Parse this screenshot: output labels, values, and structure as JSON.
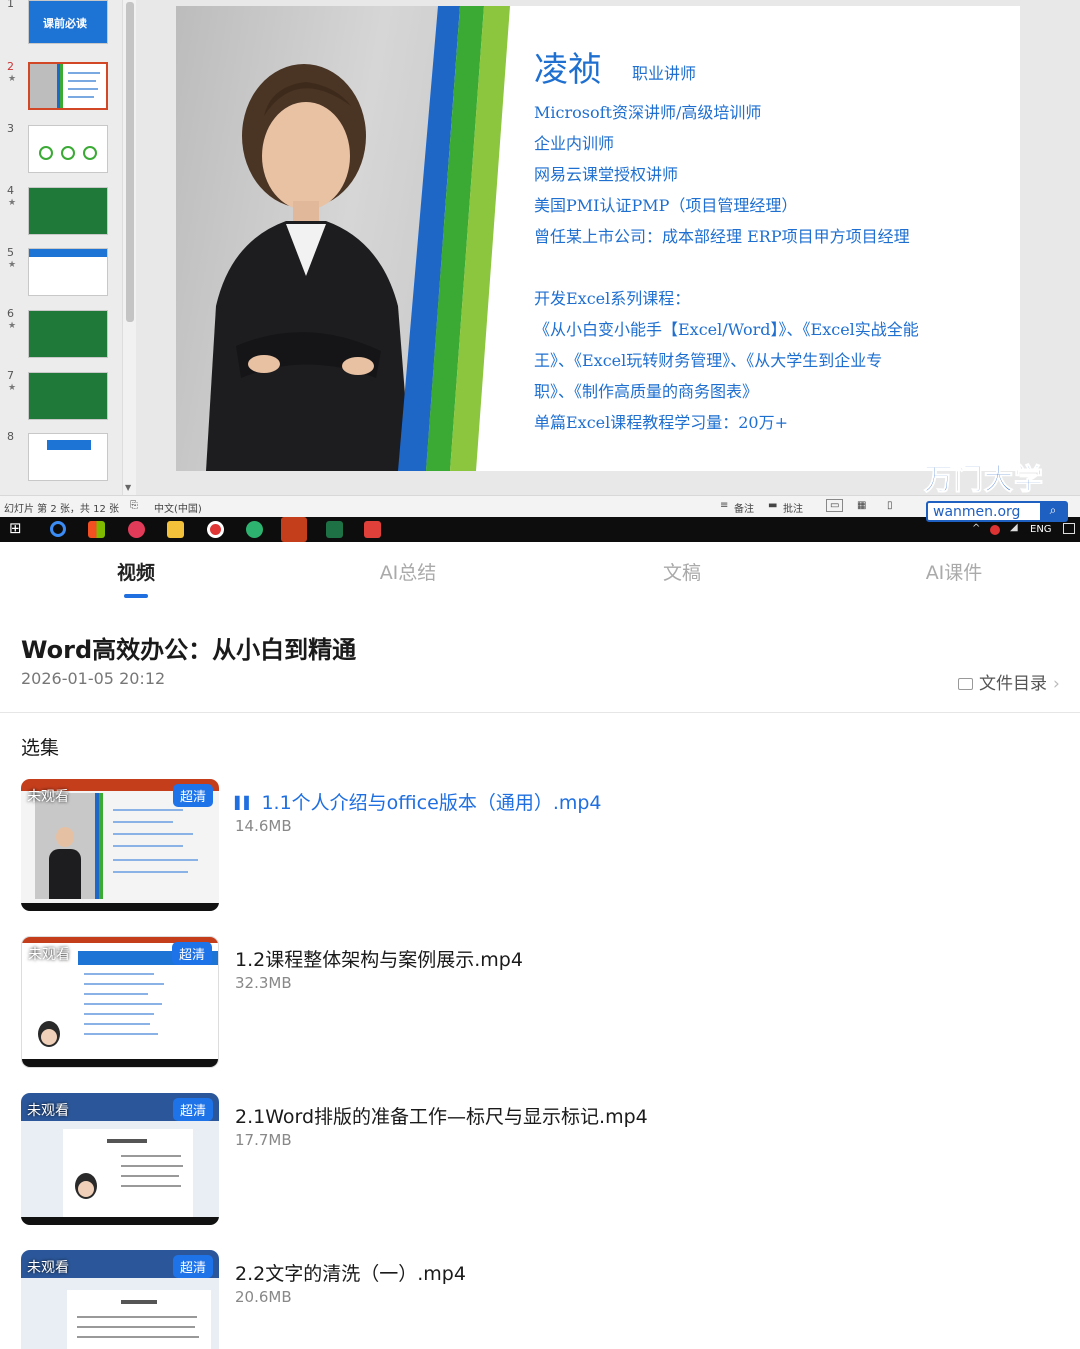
{
  "video": {
    "thumbnails": [
      {
        "num": "1",
        "star": "",
        "label": "课前必读"
      },
      {
        "num": "2",
        "star": "★",
        "label": ""
      },
      {
        "num": "3",
        "star": "",
        "label": ""
      },
      {
        "num": "4",
        "star": "★",
        "label": ""
      },
      {
        "num": "5",
        "star": "★",
        "label": ""
      },
      {
        "num": "6",
        "star": "★",
        "label": ""
      },
      {
        "num": "7",
        "star": "★",
        "label": ""
      },
      {
        "num": "8",
        "star": "",
        "label": ""
      }
    ],
    "slide": {
      "name": "凌祯",
      "role": "职业讲师",
      "lines": [
        "Microsoft资深讲师/高级培训师",
        "企业内训师",
        "网易云课堂授权讲师",
        "美国PMI认证PMP（项目管理经理）",
        "曾任某上市公司：成本部经理 ERP项目甲方项目经理",
        "",
        "开发Excel系列课程：",
        "《从小白变小能手【Excel/Word】》、《Excel实战全能",
        "王》、《Excel玩转财务管理》、《从大学生到企业专",
        "职》、《制作高质量的商务图表》",
        "单篇Excel课程教程学习量：20万+"
      ]
    },
    "statusbar": {
      "slide_info": "幻灯片 第 2 张，共 12 张",
      "language": "中文(中国)",
      "notes": "备注",
      "comments": "批注"
    },
    "taskbar": {
      "lang": "ENG"
    },
    "brand": {
      "name": "万门大学",
      "url": "wanmen.org"
    }
  },
  "tabs": [
    {
      "label": "视频",
      "active": true
    },
    {
      "label": "AI总结",
      "active": false
    },
    {
      "label": "文稿",
      "active": false
    },
    {
      "label": "AI课件",
      "active": false
    }
  ],
  "course": {
    "title": "Word高效办公：从小白到精通",
    "date": "2026-01-05 20:12",
    "catalog_label": "文件目录"
  },
  "playlist": {
    "heading": "选集",
    "episodes": [
      {
        "title": "1.1个人介绍与office版本（通用）.mp4",
        "size": "14.6MB",
        "badge": "超清",
        "status": "未观看",
        "playing": true
      },
      {
        "title": "1.2课程整体架构与案例展示.mp4",
        "size": "32.3MB",
        "badge": "超清",
        "status": "未观看",
        "playing": false
      },
      {
        "title": "2.1Word排版的准备工作—标尺与显示标记.mp4",
        "size": "17.7MB",
        "badge": "超清",
        "status": "未观看",
        "playing": false
      },
      {
        "title": "2.2文字的清洗（一）.mp4",
        "size": "20.6MB",
        "badge": "超清",
        "status": "未观看",
        "playing": false
      }
    ]
  },
  "colors": {
    "accent": "#1f6fe0",
    "slide_text": "#1e6fd0",
    "slide_blue": "#1f67c7",
    "slide_green": "#3aaa35",
    "slide_lime": "#8cc63f"
  }
}
